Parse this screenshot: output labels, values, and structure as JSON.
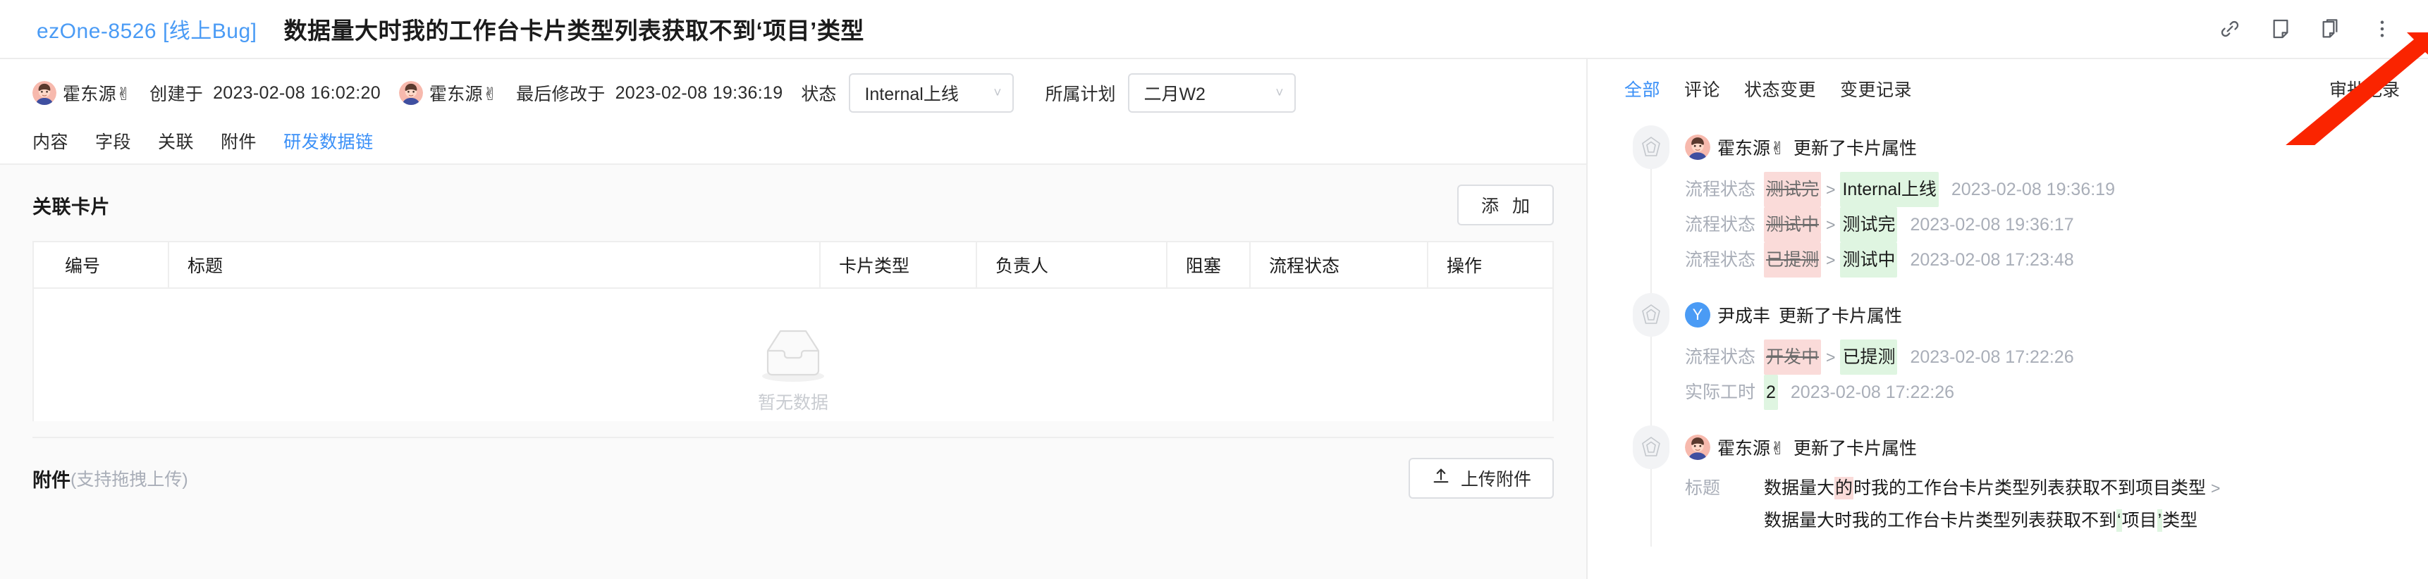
{
  "header": {
    "card_code": "ezOne-8526 [线上Bug]",
    "card_title": "数据量大时我的工作台卡片类型列表获取不到‘项目’类型",
    "icons": [
      {
        "name": "link-icon",
        "label": "复制链接"
      },
      {
        "name": "note-icon",
        "label": "备注"
      },
      {
        "name": "copy-icon",
        "label": "复制卡片"
      },
      {
        "name": "more-vertical-icon",
        "label": "更多"
      }
    ]
  },
  "meta": {
    "creator": "霍东源✌",
    "created_label": "创建于",
    "created_time": "2023-02-08 16:02:20",
    "modifier": "霍东源✌",
    "modified_label": "最后修改于",
    "modified_time": "2023-02-08 19:36:19",
    "status_label": "状态",
    "status_value": "Internal上线",
    "plan_label": "所属计划",
    "plan_value": "二月W2"
  },
  "tabs": [
    {
      "label": "内容",
      "active": false
    },
    {
      "label": "字段",
      "active": false
    },
    {
      "label": "关联",
      "active": false
    },
    {
      "label": "附件",
      "active": false
    },
    {
      "label": "研发数据链",
      "active": true
    }
  ],
  "related": {
    "section_title": "关联卡片",
    "add_button": "添 加",
    "columns": [
      "编号",
      "标题",
      "卡片类型",
      "负责人",
      "阻塞",
      "流程状态",
      "操作"
    ],
    "rows": [],
    "empty_text": "暂无数据"
  },
  "attachment": {
    "title": "附件",
    "subtitle": "(支持拖拽上传)",
    "upload_button": "上传附件"
  },
  "activity": {
    "tabs": [
      {
        "label": "全部",
        "active": true
      },
      {
        "label": "评论",
        "active": false
      },
      {
        "label": "状态变更",
        "active": false
      },
      {
        "label": "变更记录",
        "active": false
      }
    ],
    "right_tab": "审批记录",
    "entries": [
      {
        "user": "霍东源✌",
        "avatar_type": "photo",
        "action": "更新了卡片属性",
        "changes": [
          {
            "label": "流程状态",
            "old": "测试完",
            "new": "Internal上线",
            "time": "2023-02-08 19:36:19"
          },
          {
            "label": "流程状态",
            "old": "测试中",
            "new": "测试完",
            "time": "2023-02-08 19:36:17"
          },
          {
            "label": "流程状态",
            "old": "已提测",
            "new": "测试中",
            "time": "2023-02-08 17:23:48"
          }
        ]
      },
      {
        "user": "尹成丰",
        "avatar_type": "letter",
        "avatar_letter": "Y",
        "action": "更新了卡片属性",
        "changes": [
          {
            "label": "流程状态",
            "old": "开发中",
            "new": "已提测",
            "time": "2023-02-08 17:22:26"
          },
          {
            "label": "实际工时",
            "old": "",
            "new": "2",
            "time": "2023-02-08 17:22:26"
          }
        ]
      },
      {
        "user": "霍东源✌",
        "avatar_type": "photo",
        "action": "更新了卡片属性",
        "title_change": {
          "label": "标题",
          "old_prefix": "数据量大",
          "old_deleted": "的",
          "old_suffix": "时我的工作台卡片类型列表获取不到项目类型",
          "new_prefix": "数据量大时我的工作台卡片类型列表获取不到",
          "new_added_open": "‘",
          "new_middle": "项目",
          "new_added_close": "’",
          "new_suffix": "类型"
        }
      }
    ]
  },
  "colors": {
    "accent": "#3b90f7",
    "link": "#4a9bf5",
    "deleted_bg": "#fadbd9",
    "added_bg": "#dff5e1",
    "annotation_arrow": "#fa2400"
  }
}
